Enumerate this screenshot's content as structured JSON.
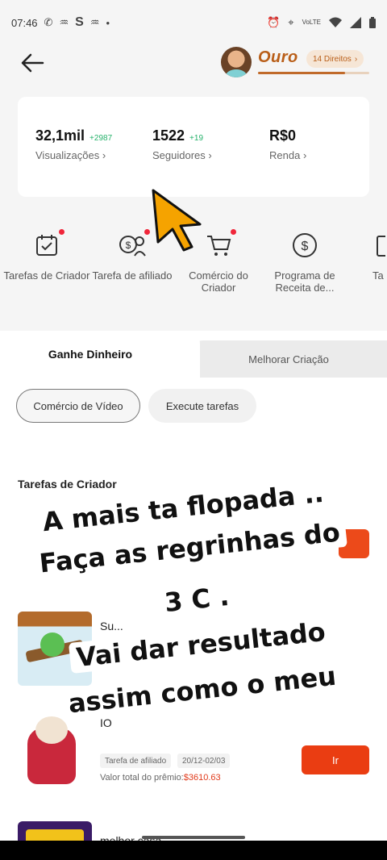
{
  "status_bar": {
    "time": "07:46",
    "icons_left": [
      "whatsapp-icon",
      "app-icon",
      "s-icon",
      "app-icon",
      "dot-icon"
    ],
    "icons_right": [
      "alarm-icon",
      "location-icon",
      "volte-icon",
      "wifi-icon",
      "signal-icon",
      "battery-icon"
    ]
  },
  "header": {
    "level": "Ouro",
    "rights_label": "14 Direitos",
    "level_progress": 0.78
  },
  "stats": [
    {
      "value": "32,1mil",
      "delta": "+2987",
      "label": "Visualizações"
    },
    {
      "value": "1522",
      "delta": "+19",
      "label": "Seguidores"
    },
    {
      "value": "R$0",
      "delta": "",
      "label": "Renda"
    }
  ],
  "tools": [
    {
      "label": "Tarefas de Criador",
      "icon": "calendar-check-icon",
      "badge": true
    },
    {
      "label": "Tarefa de afiliado",
      "icon": "coin-people-icon",
      "badge": true
    },
    {
      "label": "Comércio do Criador",
      "icon": "cart-icon",
      "badge": true
    },
    {
      "label": "Programa de Receita de...",
      "icon": "dollar-circle-icon",
      "badge": false
    },
    {
      "label": "Ta Remu",
      "icon": "task-icon",
      "badge": false
    }
  ],
  "tabs": {
    "active": "Ganhe Dinheiro",
    "inactive": "Melhorar Criação"
  },
  "chips": {
    "active": "Comércio de Vídeo",
    "other": "Execute tarefas"
  },
  "section_title": "Tarefas de Criador",
  "tasks": [
    {
      "name": "Su...",
      "tag": "",
      "date": "",
      "prize_label": "",
      "prize_value": ""
    },
    {
      "name": "IO",
      "tag": "Tarefa de afiliado",
      "date": "20/12-02/03",
      "prize_label": "Valor total do prêmio:",
      "prize_value": "$3610.63",
      "button": "Ir"
    },
    {
      "name": "melhor casa",
      "tag": "",
      "date": "",
      "prize_label": "",
      "prize_value": ""
    }
  ],
  "overlay_text": {
    "line1": "A mais ta flopada ..",
    "line2": "Faça as regrinhas do",
    "line3": "3 C .",
    "line4": "Vai dar resultado",
    "line5": "assim como o meu"
  },
  "colors": {
    "accent": "#ea3d12",
    "level_gold": "#b95e18",
    "positive": "#26b26b",
    "badge": "#f0263a",
    "cursor": "#f5a300"
  }
}
